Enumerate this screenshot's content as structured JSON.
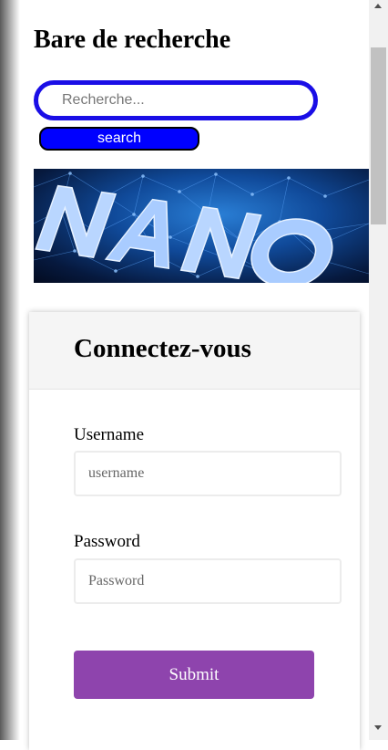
{
  "search": {
    "title": "Bare de recherche",
    "placeholder": "Recherche...",
    "button_label": "search"
  },
  "banner": {
    "image_alt": "NANO banner image",
    "wordmark": "NANO"
  },
  "login": {
    "title": "Connectez-vous",
    "username_label": "Username",
    "username_placeholder": "username",
    "password_label": "Password",
    "password_placeholder": "Password",
    "submit_label": "Submit"
  },
  "colors": {
    "search_border": "#1a0ee6",
    "search_button": "#0000ff",
    "submit_button": "#8e44ad"
  }
}
